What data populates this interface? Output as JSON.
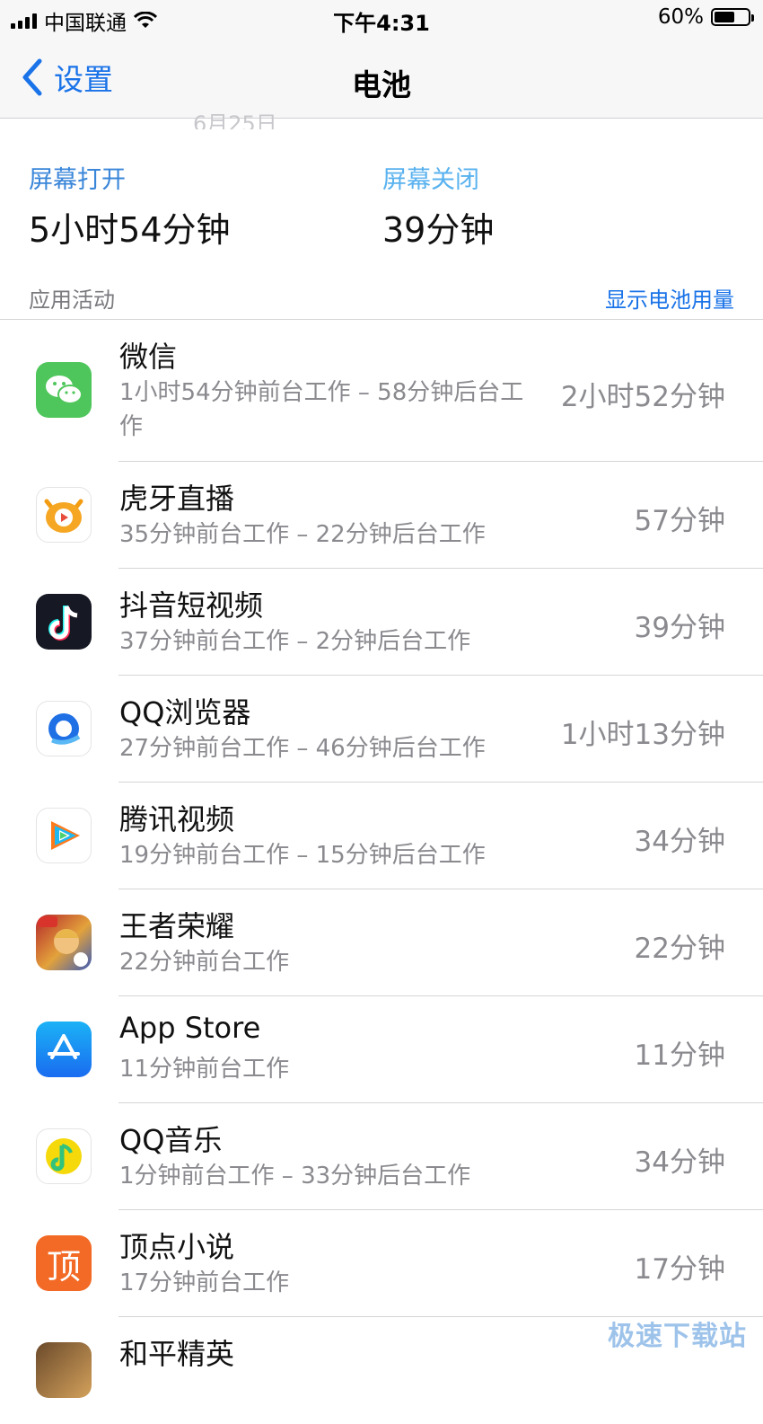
{
  "status_bar": {
    "carrier": "中国联通",
    "time": "下午4:31",
    "battery": "60%"
  },
  "nav": {
    "back_label": "设置",
    "title": "电池"
  },
  "cut_date": "6月25日",
  "screen_on": {
    "label": "屏幕打开",
    "value": "5小时54分钟"
  },
  "screen_off": {
    "label": "屏幕关闭",
    "value": "39分钟"
  },
  "section": {
    "title": "应用活动",
    "action": "显示电池用量"
  },
  "apps": [
    {
      "name": "微信",
      "detail": "1小时54分钟前台工作 – 58分钟后台工作",
      "time": "2小时52分钟",
      "icon": "wechat-icon"
    },
    {
      "name": "虎牙直播",
      "detail": "35分钟前台工作 – 22分钟后台工作",
      "time": "57分钟",
      "icon": "huya-icon"
    },
    {
      "name": "抖音短视频",
      "detail": "37分钟前台工作 – 2分钟后台工作",
      "time": "39分钟",
      "icon": "douyin-icon"
    },
    {
      "name": "QQ浏览器",
      "detail": "27分钟前台工作 – 46分钟后台工作",
      "time": "1小时13分钟",
      "icon": "qq-browser-icon"
    },
    {
      "name": "腾讯视频",
      "detail": "19分钟前台工作 – 15分钟后台工作",
      "time": "34分钟",
      "icon": "tencent-video-icon"
    },
    {
      "name": "王者荣耀",
      "detail": "22分钟前台工作",
      "time": "22分钟",
      "icon": "honor-of-kings-icon"
    },
    {
      "name": "App Store",
      "detail": "11分钟前台工作",
      "time": "11分钟",
      "icon": "app-store-icon"
    },
    {
      "name": "QQ音乐",
      "detail": "1分钟前台工作 – 33分钟后台工作",
      "time": "34分钟",
      "icon": "qq-music-icon"
    },
    {
      "name": "顶点小说",
      "detail": "17分钟前台工作",
      "time": "17分钟",
      "icon": "dingdian-novel-icon",
      "icon_text": "顶"
    },
    {
      "name": "和平精英",
      "detail": "",
      "time": "",
      "icon": "peacekeeper-elite-icon"
    }
  ],
  "watermark": "极速下载站",
  "colors": {
    "accent": "#1a73e8",
    "screen_off_label": "#59b2ef",
    "secondary_text": "#8a8a8f"
  }
}
